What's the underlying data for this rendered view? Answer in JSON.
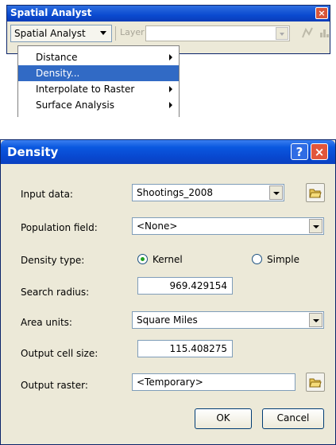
{
  "toolbar": {
    "title": "Spatial Analyst",
    "close_glyph": "×",
    "menu_button_label": "Spatial Analyst",
    "layer_label": "Layer",
    "layer_value": "",
    "menu_items": [
      {
        "label": "Distance",
        "has_submenu": true
      },
      {
        "label": "Density...",
        "has_submenu": false,
        "highlighted": true
      },
      {
        "label": "Interpolate to Raster",
        "has_submenu": true
      },
      {
        "label": "Surface Analysis",
        "has_submenu": true
      }
    ]
  },
  "dialog": {
    "title": "Density",
    "help_glyph": "?",
    "close_glyph": "×",
    "input_data": {
      "label": "Input data:",
      "value": "Shootings_2008"
    },
    "population_field": {
      "label": "Population field:",
      "value": "<None>"
    },
    "density_type": {
      "label": "Density type:",
      "options": [
        "Kernel",
        "Simple"
      ],
      "selected": "Kernel"
    },
    "search_radius": {
      "label": "Search radius:",
      "value": "969.429154"
    },
    "area_units": {
      "label": "Area units:",
      "value": "Square Miles"
    },
    "output_cell_size": {
      "label": "Output cell size:",
      "value": "115.408275"
    },
    "output_raster": {
      "label": "Output raster:",
      "value": "<Temporary>"
    },
    "ok_label": "OK",
    "cancel_label": "Cancel"
  },
  "colors": {
    "title_blue": "#0a58e0",
    "face": "#ece9d8",
    "menu_highlight": "#316ac5",
    "close_red": "#e2563b"
  }
}
